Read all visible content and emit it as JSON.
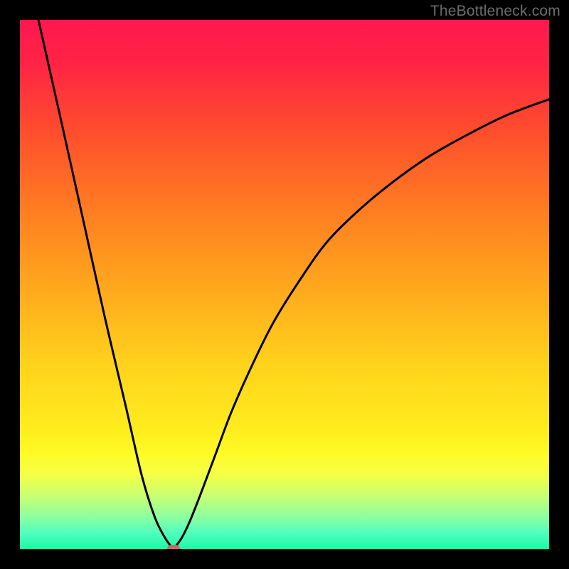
{
  "watermark": "TheBottleneck.com",
  "colors": {
    "frame": "#000000",
    "curve": "#000000",
    "marker": "#cb6a5f",
    "gradient_stops": [
      {
        "offset": 0.0,
        "color": "#ff1850"
      },
      {
        "offset": 0.08,
        "color": "#ff2345"
      },
      {
        "offset": 0.2,
        "color": "#ff4a2e"
      },
      {
        "offset": 0.35,
        "color": "#ff7a22"
      },
      {
        "offset": 0.5,
        "color": "#ffa61d"
      },
      {
        "offset": 0.65,
        "color": "#ffd21c"
      },
      {
        "offset": 0.78,
        "color": "#ffee1e"
      },
      {
        "offset": 0.82,
        "color": "#fffb27"
      },
      {
        "offset": 0.86,
        "color": "#f4ff46"
      },
      {
        "offset": 0.9,
        "color": "#c8ff74"
      },
      {
        "offset": 0.94,
        "color": "#8bffa0"
      },
      {
        "offset": 0.97,
        "color": "#4fffbe"
      },
      {
        "offset": 1.0,
        "color": "#1cf7a8"
      }
    ]
  },
  "chart_data": {
    "type": "line",
    "title": "",
    "xlabel": "",
    "ylabel": "",
    "xlim": [
      0,
      100
    ],
    "ylim": [
      0,
      100
    ],
    "grid": false,
    "series": [
      {
        "name": "left-branch",
        "x": [
          3.5,
          8,
          12,
          16,
          20,
          23,
          25.5,
          27.5,
          29
        ],
        "values": [
          100,
          80,
          62,
          44,
          27,
          14,
          6,
          2,
          0
        ]
      },
      {
        "name": "right-branch",
        "x": [
          29,
          30.5,
          32,
          34,
          37,
          40,
          44,
          48,
          53,
          58,
          64,
          70,
          77,
          84,
          92,
          100
        ],
        "values": [
          0,
          2,
          5,
          10,
          18,
          26,
          35,
          43,
          51,
          58,
          64,
          69,
          74,
          78,
          82,
          85
        ]
      }
    ],
    "annotations": [
      {
        "name": "vertex-marker",
        "x": 29,
        "y": 0,
        "color": "#cb6a5f"
      }
    ]
  }
}
